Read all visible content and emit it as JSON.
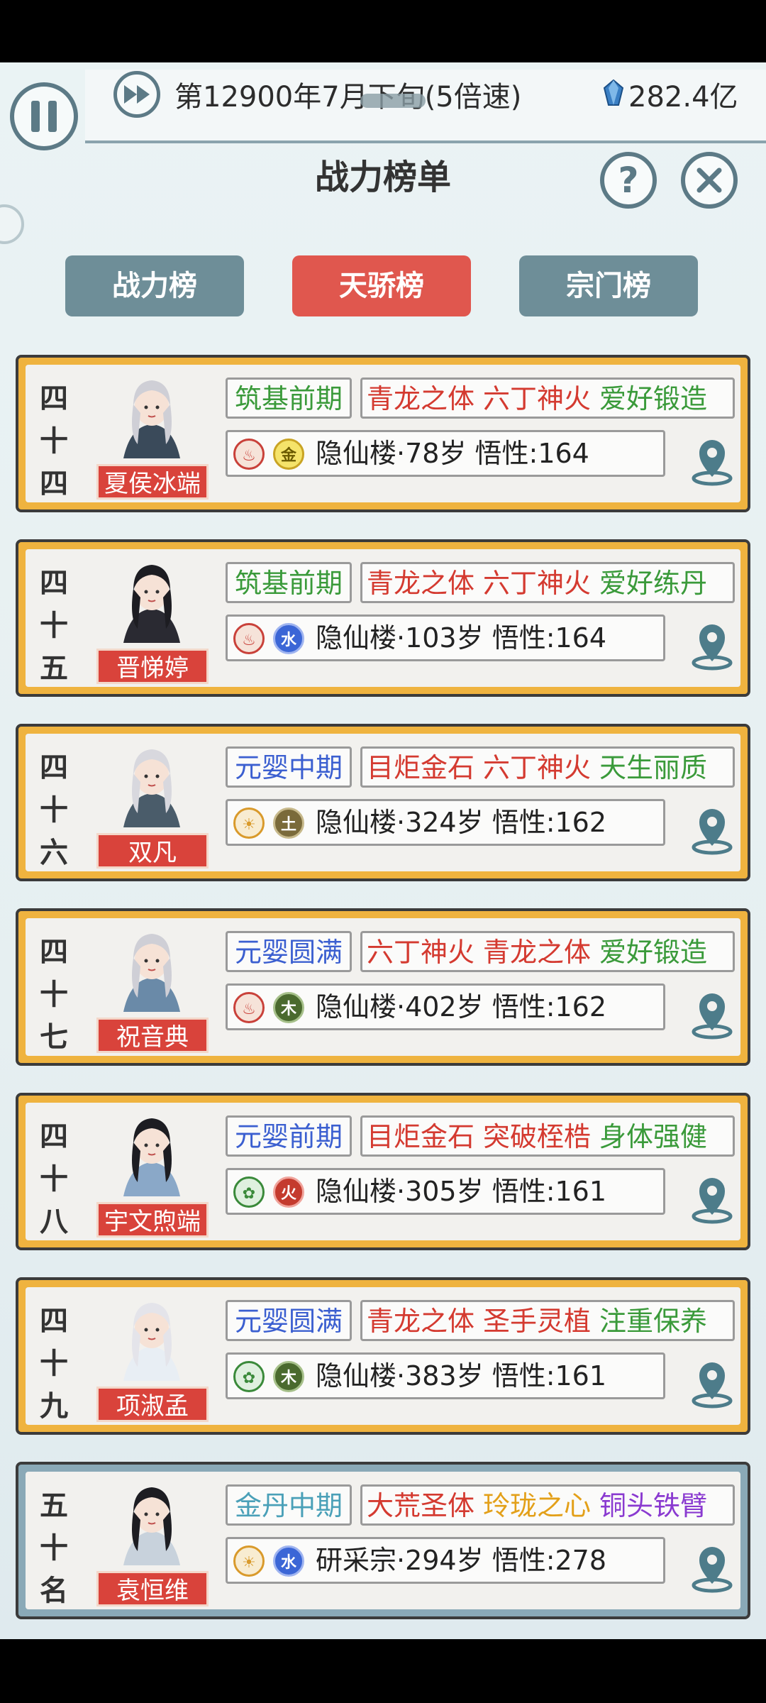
{
  "status": {
    "date": "第12900年7月下旬(5倍速)",
    "money": "282.4亿"
  },
  "header": {
    "title": "战力榜单"
  },
  "tabs": [
    {
      "label": "战力榜",
      "active": false
    },
    {
      "label": "天骄榜",
      "active": true
    },
    {
      "label": "宗门榜",
      "active": false
    }
  ],
  "colors": {
    "card_gold": "#efb33f",
    "card_blue": "#8aa9b7",
    "tab_active": "#e0574e",
    "tab_inactive": "#6e8e98",
    "trait_green": "#3a9a3a",
    "trait_red": "#d43a30",
    "stage_blue": "#3b5fd0"
  },
  "cards": [
    {
      "rank": [
        "四",
        "十",
        "四"
      ],
      "name": "夏侯冰端",
      "stage": "筑基前期",
      "stage_color": "green",
      "traits": [
        {
          "text": "青龙之体",
          "color": "red"
        },
        {
          "text": "六丁神火",
          "color": "red"
        },
        {
          "text": "爱好锻造",
          "color": "green"
        }
      ],
      "root1": {
        "icon": "fire-root-icon",
        "label": ""
      },
      "root2": {
        "icon": "metal-root-icon",
        "label": "金"
      },
      "info": "隐仙楼·78岁 悟性:164",
      "style": "gold"
    },
    {
      "rank": [
        "四",
        "十",
        "五"
      ],
      "name": "晋悌婷",
      "stage": "筑基前期",
      "stage_color": "green",
      "traits": [
        {
          "text": "青龙之体",
          "color": "red"
        },
        {
          "text": "六丁神火",
          "color": "red"
        },
        {
          "text": "爱好练丹",
          "color": "green"
        }
      ],
      "root1": {
        "icon": "fire-root-icon",
        "label": ""
      },
      "root2": {
        "icon": "water-root-icon",
        "label": "水"
      },
      "info": "隐仙楼·103岁 悟性:164",
      "style": "gold"
    },
    {
      "rank": [
        "四",
        "十",
        "六"
      ],
      "name": "双凡",
      "stage": "元婴中期",
      "stage_color": "blue",
      "traits": [
        {
          "text": "目炬金石",
          "color": "red"
        },
        {
          "text": "六丁神火",
          "color": "red"
        },
        {
          "text": "天生丽质",
          "color": "green"
        }
      ],
      "root1": {
        "icon": "sun-root-icon",
        "label": ""
      },
      "root2": {
        "icon": "earth-root-icon",
        "label": "土"
      },
      "info": "隐仙楼·324岁 悟性:162",
      "style": "gold"
    },
    {
      "rank": [
        "四",
        "十",
        "七"
      ],
      "name": "祝音典",
      "stage": "元婴圆满",
      "stage_color": "blue",
      "traits": [
        {
          "text": "六丁神火",
          "color": "red"
        },
        {
          "text": "青龙之体",
          "color": "red"
        },
        {
          "text": "爱好锻造",
          "color": "green"
        }
      ],
      "root1": {
        "icon": "fire-root-icon",
        "label": ""
      },
      "root2": {
        "icon": "wood-root-icon",
        "label": "木"
      },
      "info": "隐仙楼·402岁 悟性:162",
      "style": "gold"
    },
    {
      "rank": [
        "四",
        "十",
        "八"
      ],
      "name": "宇文煦端",
      "stage": "元婴前期",
      "stage_color": "blue",
      "traits": [
        {
          "text": "目炬金石",
          "color": "red"
        },
        {
          "text": "突破桎梏",
          "color": "red"
        },
        {
          "text": "身体强健",
          "color": "green"
        }
      ],
      "root1": {
        "icon": "leaf-root-icon",
        "label": ""
      },
      "root2": {
        "icon": "fire-element-icon",
        "label": "火"
      },
      "info": "隐仙楼·305岁 悟性:161",
      "style": "gold"
    },
    {
      "rank": [
        "四",
        "十",
        "九"
      ],
      "name": "项淑孟",
      "stage": "元婴圆满",
      "stage_color": "blue",
      "traits": [
        {
          "text": "青龙之体",
          "color": "red"
        },
        {
          "text": "圣手灵植",
          "color": "red"
        },
        {
          "text": "注重保养",
          "color": "green"
        }
      ],
      "root1": {
        "icon": "leaf-root-icon",
        "label": ""
      },
      "root2": {
        "icon": "wood-root-icon",
        "label": "木"
      },
      "info": "隐仙楼·383岁 悟性:161",
      "style": "gold"
    },
    {
      "rank": [
        "五",
        "十",
        "名"
      ],
      "name": "袁恒维",
      "stage": "金丹中期",
      "stage_color": "teal",
      "traits": [
        {
          "text": "大荒圣体",
          "color": "red"
        },
        {
          "text": "玲珑之心",
          "color": "orange"
        },
        {
          "text": "铜头铁臂",
          "color": "purple"
        }
      ],
      "root1": {
        "icon": "sun-root-icon",
        "label": ""
      },
      "root2": {
        "icon": "water-root-icon",
        "label": "水"
      },
      "info": "研采宗·294岁 悟性:278",
      "style": "blue"
    }
  ]
}
